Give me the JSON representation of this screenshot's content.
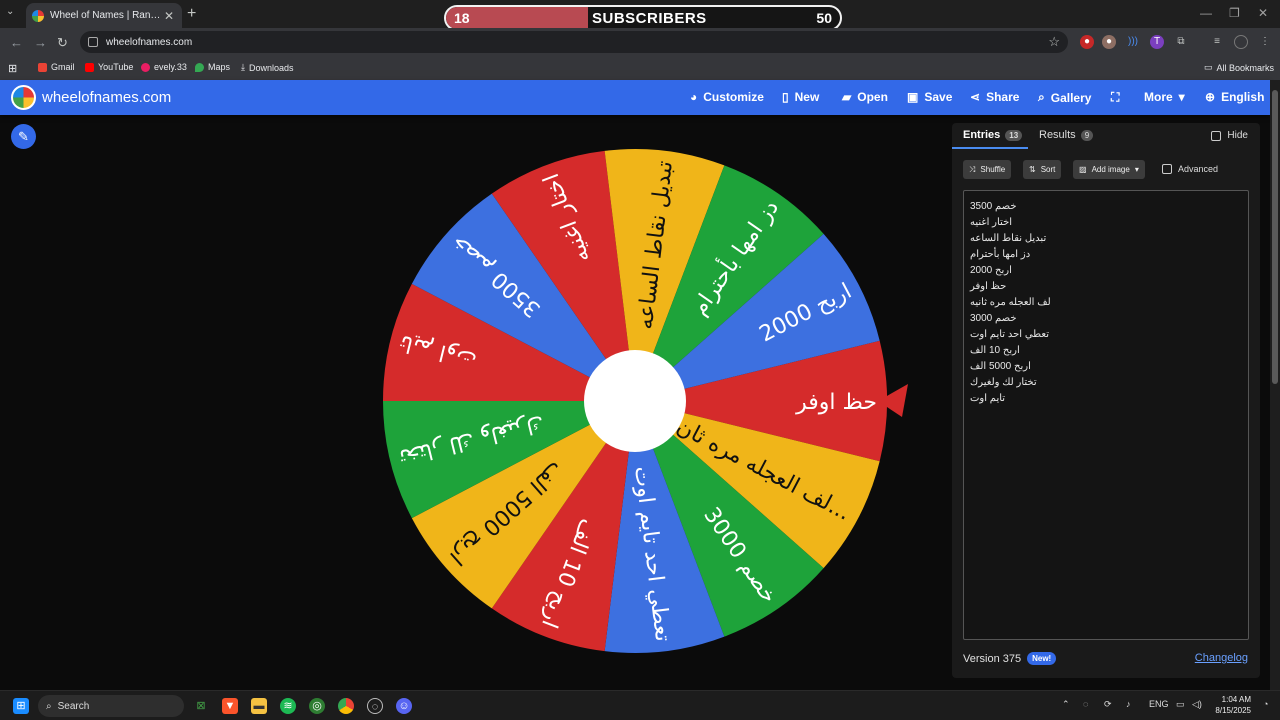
{
  "browser": {
    "tab_title": "Wheel of Names | Random nam",
    "url": "wheelofnames.com",
    "bookmarks": [
      "Gmail",
      "YouTube",
      "evely.33",
      "Maps",
      "Downloads"
    ],
    "all_bookmarks": "All Bookmarks"
  },
  "overlay": {
    "current": "18",
    "label": "SUBSCRIBERS",
    "goal": "50",
    "progress": 0.36
  },
  "site": {
    "name": "wheelofnames.com",
    "nav": [
      "Customize",
      "New",
      "Open",
      "Save",
      "Share",
      "Gallery",
      "More",
      "English"
    ]
  },
  "wheel": {
    "pointer_color": "#d52b2b",
    "segments": [
      {
        "text": "حظ اوفر",
        "color": "#d52b2b"
      },
      {
        "text": "لف العجله مره ثان...",
        "color": "#f0b519"
      },
      {
        "text": "خصم 3000",
        "color": "#1ea33a"
      },
      {
        "text": "تعطي احد تايم اوت",
        "color": "#3d70e0"
      },
      {
        "text": "اربح 10 الف",
        "color": "#d52b2b"
      },
      {
        "text": "اربح 5000 الف",
        "color": "#f0b519"
      },
      {
        "text": "تختار لك ولغيرك",
        "color": "#1ea33a"
      },
      {
        "text": "تايم اوت",
        "color": "#d52b2b"
      },
      {
        "text": "خصم 3500",
        "color": "#3d70e0"
      },
      {
        "text": "اختار اغنيه",
        "color": "#d52b2b"
      },
      {
        "text": "تبديل نقاط الساعه",
        "color": "#f0b519"
      },
      {
        "text": "دز امها بأحترام",
        "color": "#1ea33a"
      },
      {
        "text": "اربح 2000",
        "color": "#3d70e0"
      }
    ]
  },
  "panel": {
    "entries_tab": "Entries",
    "entries_count": "13",
    "results_tab": "Results",
    "results_count": "9",
    "hide": "Hide",
    "shuffle": "Shuffle",
    "sort": "Sort",
    "add_image": "Add image",
    "advanced": "Advanced",
    "entries": [
      "خصم 3500",
      "اختار اغنيه",
      "تبديل نقاط الساعه",
      "دز امها بأحترام",
      "اربح 2000",
      "حظ اوفر",
      "لف العجله مره ثانيه",
      "خصم 3000",
      "تعطي احد تايم اوت",
      "اربح 10 الف",
      "اربح 5000 الف",
      "تختار لك ولغيرك",
      "تايم اوت"
    ],
    "version": "Version 375",
    "new_badge": "New!",
    "changelog": "Changelog"
  },
  "taskbar": {
    "search": "Search",
    "lang": "ENG",
    "time": "1:04 AM",
    "date": "8/15/2025"
  }
}
